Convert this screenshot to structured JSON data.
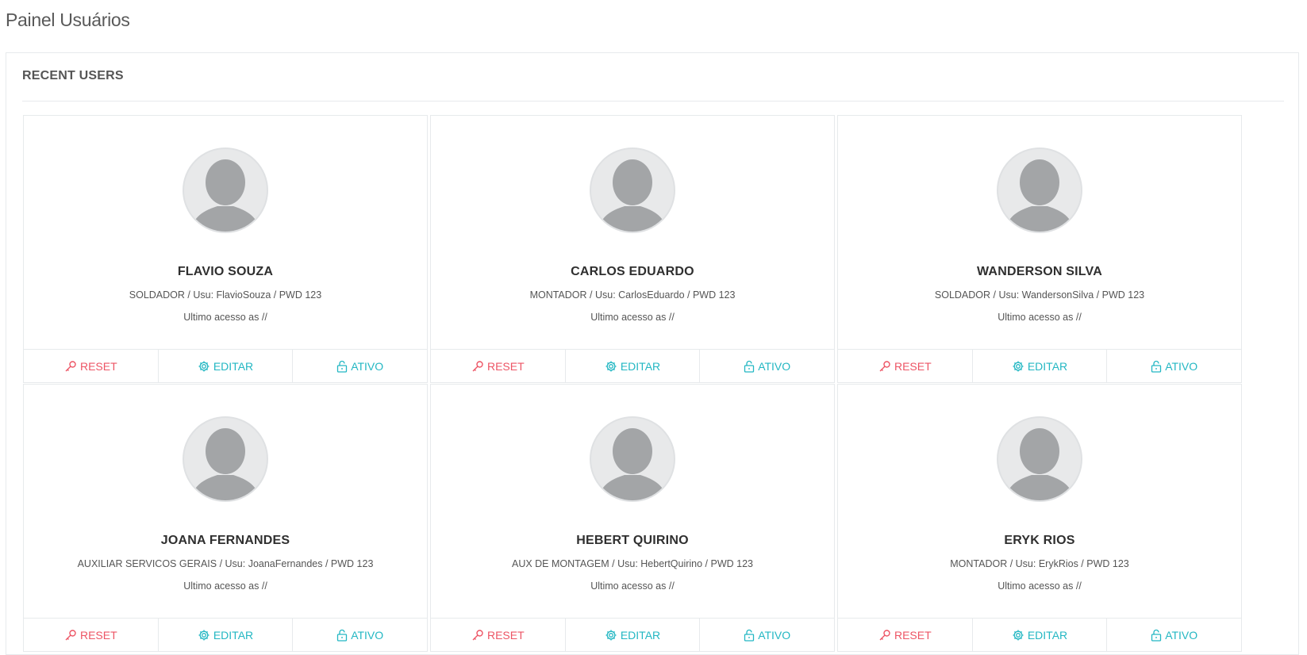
{
  "page": {
    "title": "Painel Usuários"
  },
  "panel": {
    "heading": "RECENT USERS"
  },
  "colors": {
    "reset": "#ed5565",
    "accent": "#23b7c3",
    "avatar_bg": "#e8e9ea",
    "avatar_fg": "#a3a5a7"
  },
  "icons": {
    "reset": "key-icon",
    "edit": "gear-icon",
    "active": "unlock-icon",
    "avatar": "user-silhouette-icon"
  },
  "users": [
    {
      "name": "FLAVIO SOUZA",
      "info": "SOLDADOR / Usu: FlavioSouza / PWD 123",
      "access": "Ultimo acesso as //",
      "reset_label": "RESET",
      "edit_label": "EDITAR",
      "status_label": "ATIVO"
    },
    {
      "name": "CARLOS EDUARDO",
      "info": "MONTADOR / Usu: CarlosEduardo / PWD 123",
      "access": "Ultimo acesso as //",
      "reset_label": "RESET",
      "edit_label": "EDITAR",
      "status_label": "ATIVO"
    },
    {
      "name": "WANDERSON SILVA",
      "info": "SOLDADOR / Usu: WandersonSilva / PWD 123",
      "access": "Ultimo acesso as //",
      "reset_label": "RESET",
      "edit_label": "EDITAR",
      "status_label": "ATIVO"
    },
    {
      "name": "JOANA FERNANDES",
      "info": "AUXILIAR SERVICOS GERAIS / Usu: JoanaFernandes / PWD 123",
      "access": "Ultimo acesso as //",
      "reset_label": "RESET",
      "edit_label": "EDITAR",
      "status_label": "ATIVO"
    },
    {
      "name": "HEBERT QUIRINO",
      "info": "AUX DE MONTAGEM / Usu: HebertQuirino / PWD 123",
      "access": "Ultimo acesso as //",
      "reset_label": "RESET",
      "edit_label": "EDITAR",
      "status_label": "ATIVO"
    },
    {
      "name": "ERYK RIOS",
      "info": "MONTADOR / Usu: ErykRios / PWD 123",
      "access": "Ultimo acesso as //",
      "reset_label": "RESET",
      "edit_label": "EDITAR",
      "status_label": "ATIVO"
    }
  ]
}
